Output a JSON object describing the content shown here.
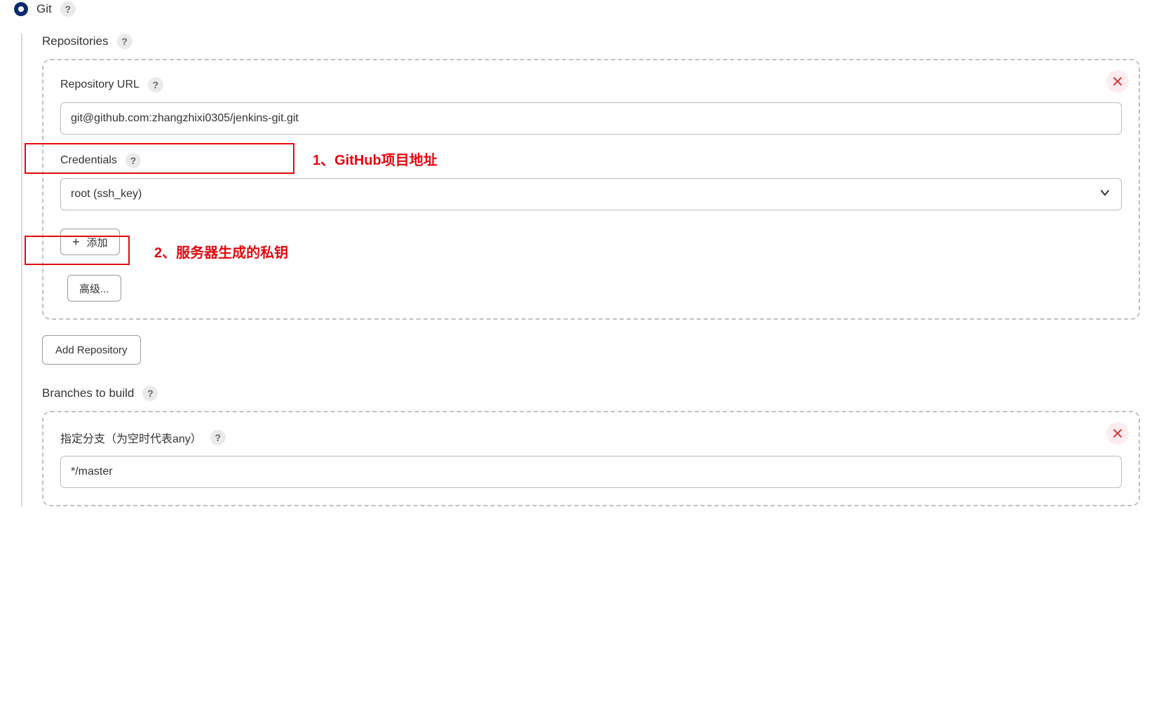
{
  "scm": {
    "git_label": "Git"
  },
  "repositories": {
    "section_label": "Repositories",
    "url_label": "Repository URL",
    "url_value": "git@github.com:zhangzhixi0305/jenkins-git.git",
    "credentials_label": "Credentials",
    "credentials_value": "root (ssh_key)",
    "add_button": "添加",
    "advanced_button": "高级...",
    "add_repo_button": "Add Repository"
  },
  "branches": {
    "section_label": "Branches to build",
    "branch_label": "指定分支（为空时代表any）",
    "branch_value": "*/master"
  },
  "annotations": {
    "note1": "1、GitHub项目地址",
    "note2": "2、服务器生成的私钥"
  }
}
